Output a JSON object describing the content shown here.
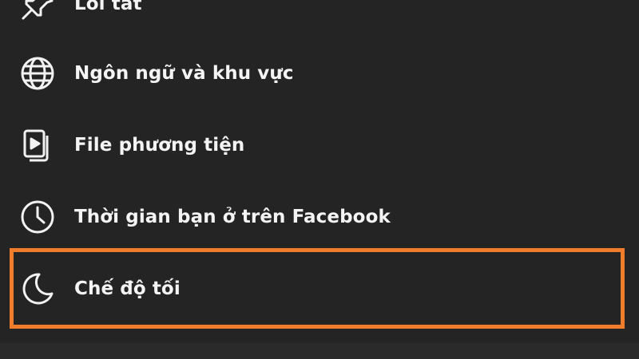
{
  "menu": {
    "items": [
      {
        "id": "shortcuts",
        "label": "Lối tắt",
        "icon": "pin-icon"
      },
      {
        "id": "language",
        "label": "Ngôn ngữ và khu vực",
        "icon": "globe-icon"
      },
      {
        "id": "media",
        "label": "File phương tiện",
        "icon": "media-files-icon"
      },
      {
        "id": "time",
        "label": "Thời gian bạn ở trên Facebook",
        "icon": "clock-icon"
      },
      {
        "id": "dark_mode",
        "label": "Chế độ tối",
        "icon": "moon-icon"
      }
    ]
  },
  "colors": {
    "background": "#242424",
    "text": "#f4f4f4",
    "highlight": "#f07d2c"
  }
}
